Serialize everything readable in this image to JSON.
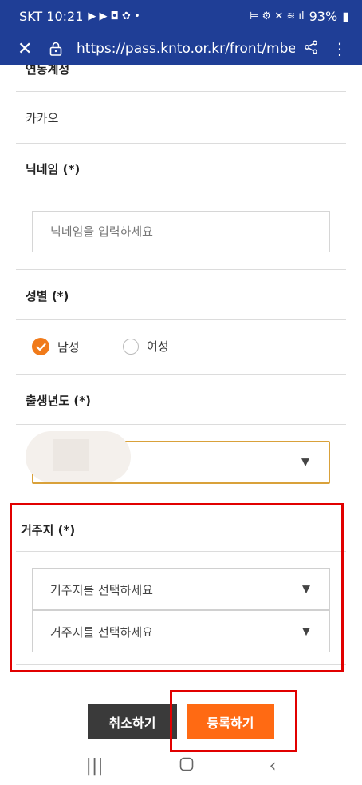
{
  "status_bar": {
    "carrier_time": "SKT 10:21",
    "battery": "93%"
  },
  "browser": {
    "url": "https://pass.knto.or.kr/front/mbe"
  },
  "form": {
    "partial_label": "연동계정",
    "kakao_value": "카카오",
    "nickname_label": "닉네임 (*)",
    "nickname_placeholder": "닉네임을 입력하세요",
    "gender_label": "성별 (*)",
    "gender_options": [
      {
        "label": "남성",
        "checked": true
      },
      {
        "label": "여성",
        "checked": false
      }
    ],
    "birth_label": "출생년도 (*)",
    "residence_label": "거주지 (*)",
    "residence_select_1": "거주지를 선택하세요",
    "residence_select_2": "거주지를 선택하세요"
  },
  "buttons": {
    "cancel": "취소하기",
    "submit": "등록하기"
  },
  "colors": {
    "header_bg": "#1f3e96",
    "accent_orange": "#ff6a13",
    "highlight_red": "#e10000",
    "select_focus_border": "#d9a13a"
  }
}
